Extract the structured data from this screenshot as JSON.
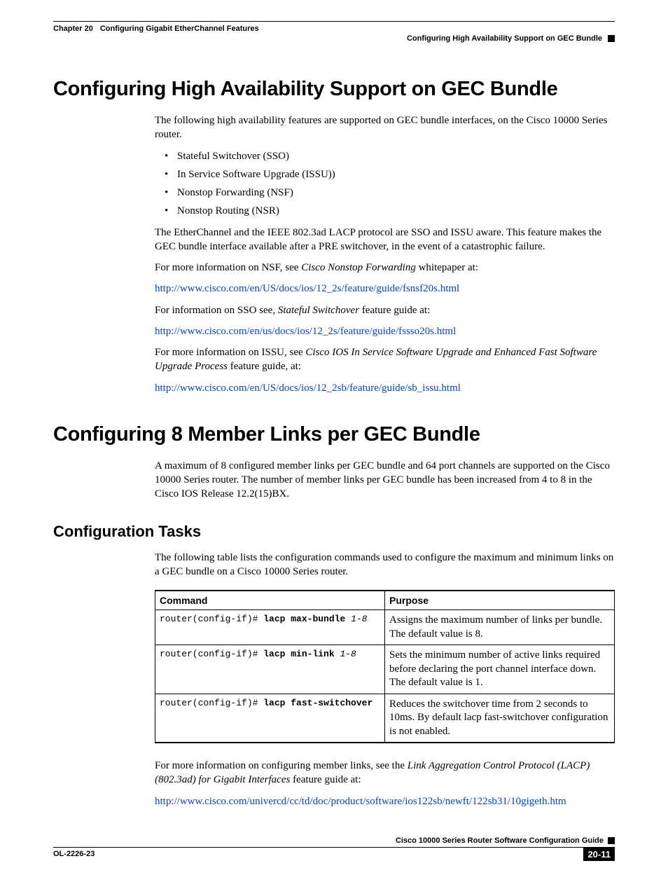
{
  "header": {
    "chapter": "Chapter 20",
    "chapter_title": "Configuring Gigabit EtherChannel Features",
    "section": "Configuring High Availability Support on GEC Bundle"
  },
  "section1": {
    "heading": "Configuring High Availability Support on GEC Bundle",
    "intro": "The following high availability features are supported on GEC bundle interfaces, on the Cisco 10000 Series router.",
    "features": [
      "Stateful Switchover (SSO)",
      "In Service Software Upgrade (ISSU))",
      "Nonstop Forwarding (NSF)",
      "Nonstop Routing (NSR)"
    ],
    "para_sso": "The EtherChannel and the IEEE 802.3ad LACP protocol are SSO and ISSU aware. This feature makes the GEC bundle interface available after a PRE switchover, in the event of a catastrophic failure.",
    "nsf_lead": "For more information on NSF, see ",
    "nsf_doc": "Cisco Nonstop Forwarding",
    "nsf_tail": " whitepaper at:",
    "nsf_link": "http://www.cisco.com/en/US/docs/ios/12_2s/feature/guide/fsnsf20s.html",
    "sso_lead": "For information on SSO see, ",
    "sso_doc": "Stateful Switchover",
    "sso_tail": " feature guide at:",
    "sso_link": "http://www.cisco.com/en/us/docs/ios/12_2s/feature/guide/fssso20s.html",
    "issu_lead": "For more information on ISSU, see ",
    "issu_doc": "Cisco IOS In Service Software Upgrade and Enhanced Fast Software Upgrade Process",
    "issu_tail": " feature guide, at:",
    "issu_link": "http://www.cisco.com/en/US/docs/ios/12_2sb/feature/guide/sb_issu.html"
  },
  "section2": {
    "heading": "Configuring 8 Member Links per GEC Bundle",
    "intro": "A maximum of 8 configured member links per GEC bundle and 64 port channels are supported on the Cisco 10000 Series router. The number of member links per GEC bundle has been increased from 4 to 8 in the Cisco IOS Release 12.2(15)BX.",
    "subheading": "Configuration Tasks",
    "tasks_intro": "The following table lists the configuration commands used to configure the maximum and minimum links on a GEC bundle on a Cisco 10000 Series router.",
    "table": {
      "col1": "Command",
      "col2": "Purpose",
      "rows": [
        {
          "prompt": "router(config-if)# ",
          "kw": "lacp max-bundle ",
          "arg": "1-8",
          "purpose": "Assigns the maximum number of links per bundle. The default value is 8."
        },
        {
          "prompt": "router(config-if)# ",
          "kw": "lacp min-link ",
          "arg": "1-8",
          "purpose": "Sets the minimum number of active links required before declaring the port channel interface down. The default value is 1."
        },
        {
          "prompt": "router(config-if)# ",
          "kw": "lacp fast-switchover",
          "arg": "",
          "purpose": "Reduces the switchover time from 2 seconds to 10ms. By default lacp fast-switchover configuration is not enabled."
        }
      ]
    },
    "more_lead": "For more information on configuring member links, see the ",
    "more_doc": "Link Aggregation Control Protocol (LACP) (802.3ad) for Gigabit Interfaces",
    "more_tail": " feature guide at:",
    "more_link": "http://www.cisco.com/univercd/cc/td/doc/product/software/ios122sb/newft/122sb31/10gigeth.htm"
  },
  "footer": {
    "guide_title": "Cisco 10000 Series Router Software Configuration Guide",
    "doc_id": "OL-2226-23",
    "page_num": "20-11"
  }
}
